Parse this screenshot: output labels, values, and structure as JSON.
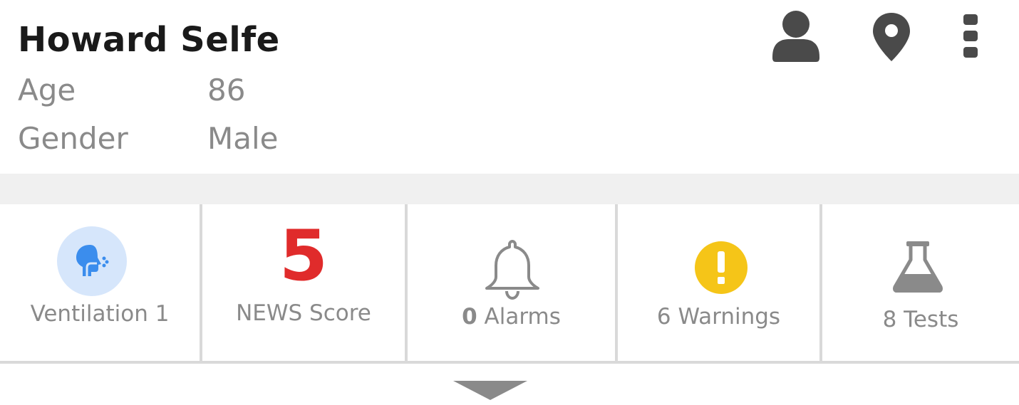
{
  "patient": {
    "name": "Howard Selfe",
    "age_label": "Age",
    "age_value": "86",
    "gender_label": "Gender",
    "gender_value": "Male"
  },
  "header_icons": [
    "person-icon",
    "location-pin-icon",
    "more-vertical-icon"
  ],
  "tiles": {
    "ventilation": {
      "label": "Ventilation 1",
      "icon": "ventilation-icon"
    },
    "news": {
      "score": "5",
      "label": "NEWS Score"
    },
    "alarms": {
      "count": "0",
      "label": "Alarms",
      "icon": "bell-icon"
    },
    "warnings": {
      "label": "6 Warnings",
      "icon": "warning-icon"
    },
    "tests": {
      "label": "8 Tests",
      "icon": "flask-icon"
    }
  },
  "colors": {
    "news_score": "#e02b2b",
    "warning": "#f5c518",
    "ventilation_bg": "#d6e6fb",
    "ventilation_icon": "#3b8ded",
    "icon_gray": "#4a4a4a",
    "muted_text": "#8a8a8a"
  }
}
